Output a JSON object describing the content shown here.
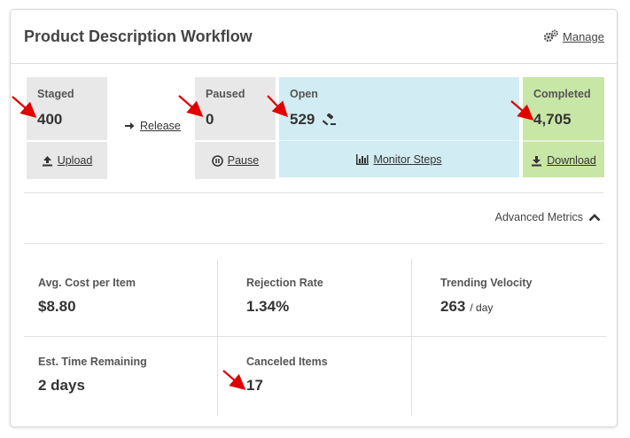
{
  "header": {
    "title": "Product Description Workflow",
    "manage_label": "Manage"
  },
  "stages": {
    "staged": {
      "label": "Staged",
      "value": "400",
      "action": "Upload"
    },
    "release": {
      "label": "Release"
    },
    "paused": {
      "label": "Paused",
      "value": "0",
      "action": "Pause"
    },
    "open": {
      "label": "Open",
      "value": "529",
      "action": "Monitor Steps"
    },
    "completed": {
      "label": "Completed",
      "value": "4,705",
      "action": "Download"
    }
  },
  "advanced_metrics": {
    "label": "Advanced Metrics"
  },
  "metrics": {
    "avg_cost": {
      "label": "Avg. Cost per Item",
      "value": "$8.80"
    },
    "rejection_rate": {
      "label": "Rejection Rate",
      "value": "1.34%"
    },
    "trending_velocity": {
      "label": "Trending Velocity",
      "value": "263",
      "unit": "/ day"
    },
    "est_time": {
      "label": "Est. Time Remaining",
      "value": "2 days"
    },
    "canceled": {
      "label": "Canceled Items",
      "value": "17"
    }
  },
  "colors": {
    "staged_bg": "#e8e8e8",
    "open_bg": "#d1ecf2",
    "completed_bg": "#c8e6a6",
    "annotation_arrow": "#e00000"
  },
  "icons": [
    "gears-icon",
    "upload-icon",
    "arrow-right-icon",
    "pause-icon",
    "gavel-icon",
    "bar-chart-icon",
    "download-icon",
    "chevron-up-icon"
  ]
}
